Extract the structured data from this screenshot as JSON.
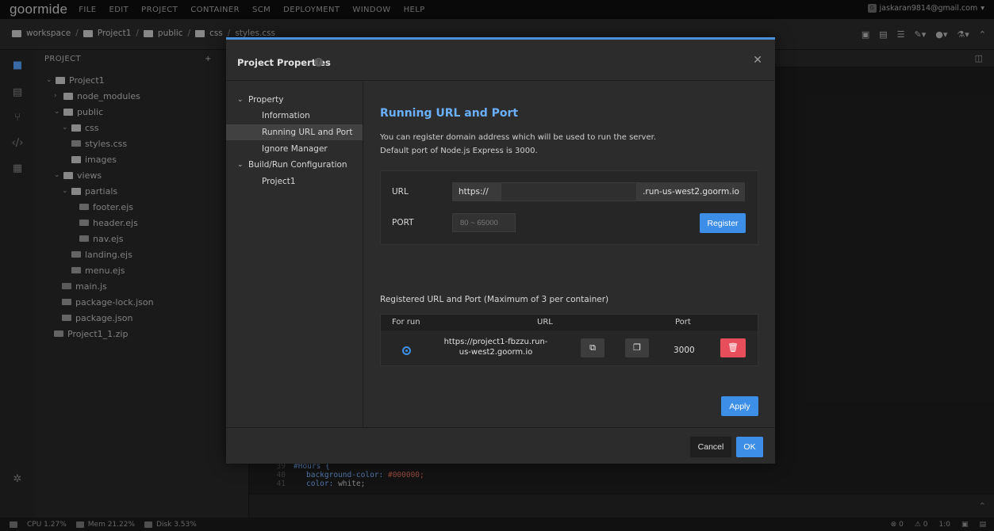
{
  "app": {
    "logo": "goormide",
    "menu": [
      "FILE",
      "EDIT",
      "PROJECT",
      "CONTAINER",
      "SCM",
      "DEPLOYMENT",
      "WINDOW",
      "HELP"
    ],
    "account": "jaskaran9814@gmail.com"
  },
  "breadcrumb": [
    "workspace",
    "Project1",
    "public",
    "css",
    "styles.css"
  ],
  "explorer": {
    "header": "PROJECT",
    "tree": [
      {
        "label": "Project1",
        "type": "folder"
      },
      {
        "label": "node_modules",
        "type": "folder"
      },
      {
        "label": "public",
        "type": "folder"
      },
      {
        "label": "css",
        "type": "folder"
      },
      {
        "label": "styles.css",
        "type": "file"
      },
      {
        "label": "images",
        "type": "folder"
      },
      {
        "label": "views",
        "type": "folder"
      },
      {
        "label": "partials",
        "type": "folder"
      },
      {
        "label": "footer.ejs",
        "type": "file"
      },
      {
        "label": "header.ejs",
        "type": "file"
      },
      {
        "label": "nav.ejs",
        "type": "file"
      },
      {
        "label": "landing.ejs",
        "type": "file"
      },
      {
        "label": "menu.ejs",
        "type": "file"
      },
      {
        "label": "main.js",
        "type": "file"
      },
      {
        "label": "package-lock.json",
        "type": "file"
      },
      {
        "label": "package.json",
        "type": "file"
      },
      {
        "label": "Project1_1.zip",
        "type": "file"
      }
    ]
  },
  "code": {
    "lines": [
      {
        "num": "39",
        "text": "#Hours {"
      },
      {
        "num": "40",
        "prop": "background-color:",
        "value": "#000000;"
      },
      {
        "num": "41",
        "prop": "color:",
        "value": "white;"
      }
    ]
  },
  "status": {
    "cpu": "CPU 1.27%",
    "mem": "Mem 21.22%",
    "disk": "Disk 3.53%",
    "errors": "0",
    "warnings": "0",
    "position": "1:0"
  },
  "modal": {
    "title": "Project Properties",
    "nav": {
      "property": "Property",
      "information": "Information",
      "running_url": "Running URL and Port",
      "ignore_manager": "Ignore Manager",
      "build_run": "Build/Run Configuration",
      "project1": "Project1"
    },
    "section_title": "Running URL and Port",
    "desc_line1": "You can register domain address which will be used to run the server.",
    "desc_line2": "Default port of Node.js Express is 3000.",
    "url_label": "URL",
    "url_prefix": "https://",
    "url_value": "",
    "url_suffix": ".run-us-west2.goorm.io",
    "port_label": "PORT",
    "port_placeholder": "80 ~ 65000",
    "register_label": "Register",
    "registered_title": "Registered URL and Port (Maximum of 3 per container)",
    "table": {
      "headers": {
        "for_run": "For run",
        "url": "URL",
        "port": "Port"
      },
      "row": {
        "url_line1": "https://project1-fbzzu.run-",
        "url_line2": "us-west2.goorm.io",
        "port": "3000",
        "selected": true
      }
    },
    "apply_label": "Apply",
    "cancel_label": "Cancel",
    "ok_label": "OK"
  },
  "colors": {
    "accent": "#3d8ee6",
    "title_blue": "#6ab0ff",
    "danger": "#e84d5b"
  }
}
